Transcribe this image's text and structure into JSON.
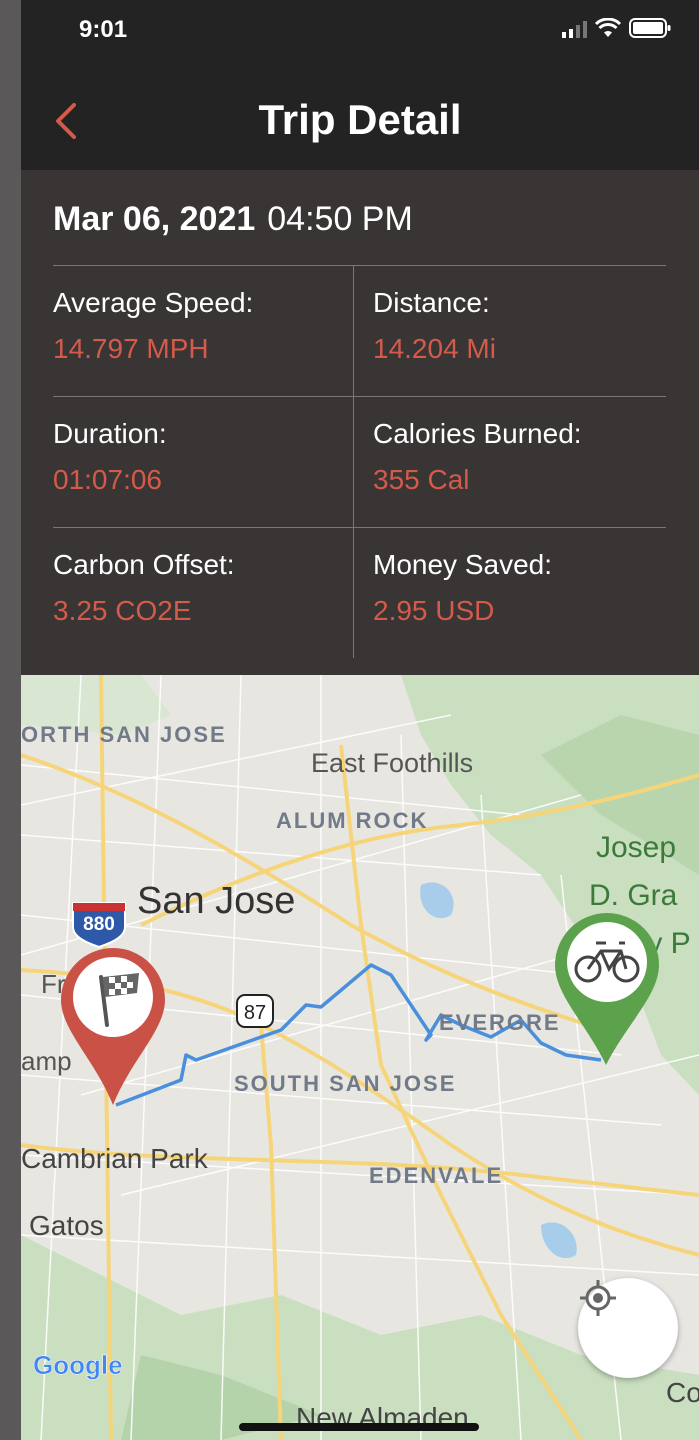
{
  "status_bar": {
    "time": "9:01"
  },
  "nav": {
    "title": "Trip Detail",
    "back_icon": "chevron-left-icon"
  },
  "trip": {
    "date": "Mar 06, 2021",
    "time": "04:50 PM"
  },
  "stats": {
    "average_speed": {
      "label": "Average Speed:",
      "value": "14.797 MPH"
    },
    "distance": {
      "label": "Distance:",
      "value": "14.204 Mi"
    },
    "duration": {
      "label": "Duration:",
      "value": "01:07:06"
    },
    "calories": {
      "label": "Calories Burned:",
      "value": "355 Cal"
    },
    "carbon": {
      "label": "Carbon Offset:",
      "value": "3.25 CO2E"
    },
    "money": {
      "label": "Money Saved:",
      "value": "2.95 USD"
    }
  },
  "map": {
    "labels": {
      "north_san_jose": "ORTH SAN JOSE",
      "east_foothills": "East Foothills",
      "alum_rock": "ALUM ROCK",
      "san_jose": "San Jose",
      "joseph1": "Josep",
      "joseph2": "D. Gra",
      "joseph3": "ty P",
      "campbell": "amp",
      "fruitdale": "Fr",
      "evergreen": "EVERGRE",
      "south_san_jose": "SOUTH SAN JOSE",
      "cambrian": "Cambrian Park",
      "edenvale": "EDENVALE",
      "los_gatos": "Gatos",
      "new_almaden": "New Almaden",
      "coyote": "Coy",
      "shield_880": "880",
      "shield_87": "87",
      "google": "Google"
    },
    "end_marker_icon": "checkered-flag-icon",
    "start_marker_icon": "bicycle-icon",
    "locate_icon": "my-location-icon",
    "colors": {
      "route": "#4a8fdc",
      "end_pin": "#c95146",
      "start_pin": "#5ca24c",
      "accent": "#d45a49"
    }
  }
}
